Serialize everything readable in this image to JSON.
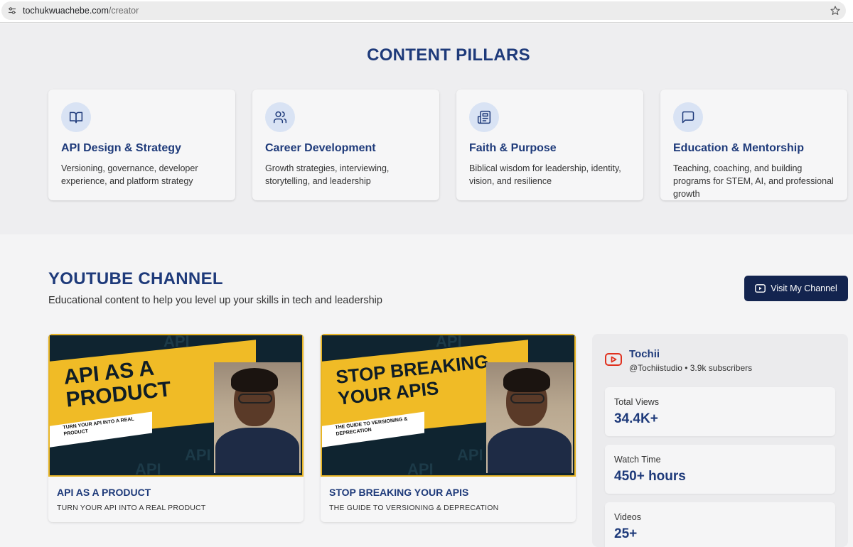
{
  "browser": {
    "url_domain": "tochukwuachebe.com",
    "url_path": "/creator"
  },
  "pillars": {
    "title": "CONTENT PILLARS",
    "items": [
      {
        "icon": "book-open-icon",
        "title": "API Design & Strategy",
        "description": "Versioning, governance, developer experience, and platform strategy"
      },
      {
        "icon": "users-icon",
        "title": "Career Development",
        "description": "Growth strategies, interviewing, storytelling, and leadership"
      },
      {
        "icon": "newspaper-icon",
        "title": "Faith & Purpose",
        "description": "Biblical wisdom for leadership, identity, vision, and resilience"
      },
      {
        "icon": "message-square-icon",
        "title": "Education & Mentorship",
        "description": "Teaching, coaching, and building programs for STEM, AI, and professional growth"
      }
    ]
  },
  "youtube": {
    "title": "YOUTUBE CHANNEL",
    "subtitle": "Educational content to help you level up your skills in tech and leadership",
    "visit_label": "Visit My Channel",
    "videos": [
      {
        "thumb_line1": "API AS A",
        "thumb_line2": "PRODUCT",
        "thumb_tag": "TURN YOUR API INTO A REAL PRODUCT",
        "title": "API AS A PRODUCT",
        "subtitle": "TURN YOUR API INTO A REAL PRODUCT"
      },
      {
        "thumb_line1": "STOP BREAKING",
        "thumb_line2": "YOUR APIS",
        "thumb_tag": "THE GUIDE TO VERSIONING & DEPRECATION",
        "title": "STOP BREAKING YOUR APIS",
        "subtitle": "THE GUIDE TO VERSIONING & DEPRECATION"
      }
    ],
    "thumb_watermark": "API",
    "channel": {
      "name": "Tochii",
      "meta": "@Tochiistudio • 3.9k subscribers",
      "stats": [
        {
          "label": "Total Views",
          "value": "34.4K+"
        },
        {
          "label": "Watch Time",
          "value": "450+ hours"
        },
        {
          "label": "Videos",
          "value": "25+"
        }
      ]
    }
  },
  "colors": {
    "heading": "#1e3a7a",
    "button_bg": "#13244f",
    "icon_circle": "#d9e3f4",
    "thumb_yellow": "#f0bb26",
    "youtube_red": "#e0301e"
  }
}
